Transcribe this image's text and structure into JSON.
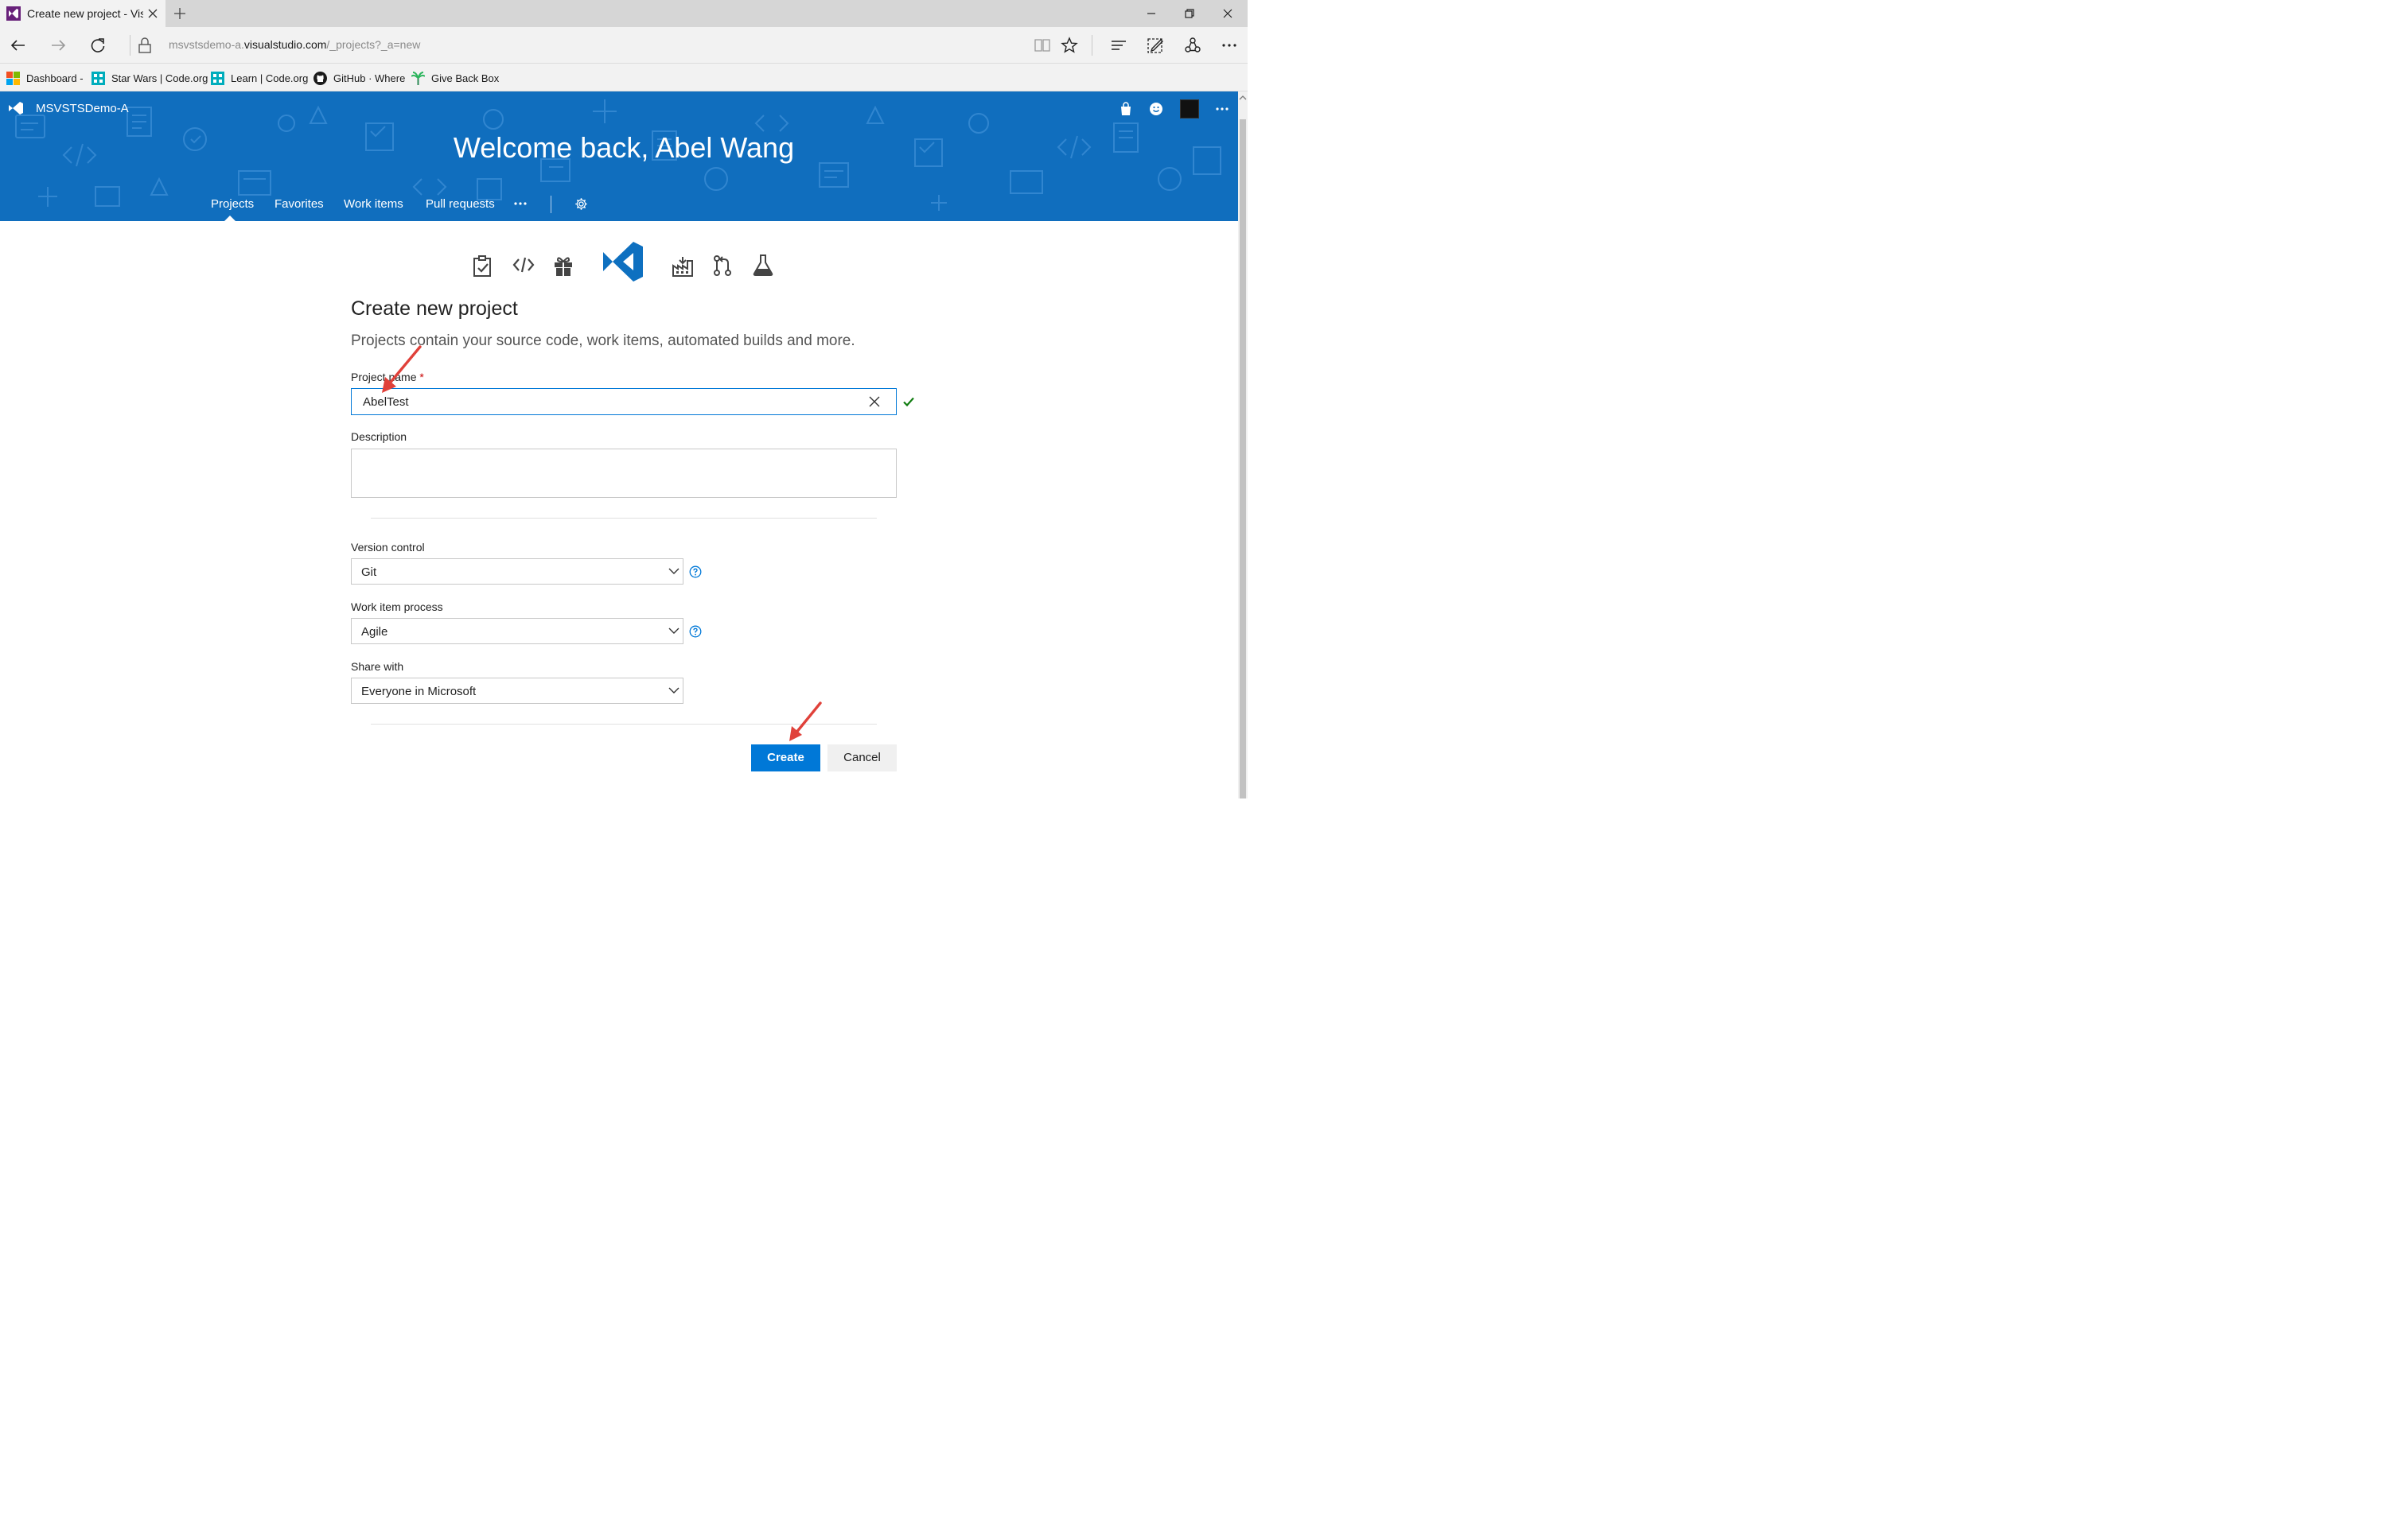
{
  "browser": {
    "tab_title": "Create new project - Vis",
    "url_prefix": "msvstsdemo-a.",
    "url_domain": "visualstudio.com",
    "url_path": "/_projects?_a=new"
  },
  "favorites": [
    {
      "label": "Dashboard -",
      "icon": "windows-logo-icon"
    },
    {
      "label": "Star Wars | Code.org",
      "icon": "code-org-icon"
    },
    {
      "label": "Learn | Code.org",
      "icon": "code-org-icon"
    },
    {
      "label": "GitHub · Where",
      "icon": "github-icon"
    },
    {
      "label": "Give Back Box",
      "icon": "palm-tree-icon"
    }
  ],
  "header": {
    "account": "MSVSTSDemo-A",
    "welcome": "Welcome back, Abel Wang",
    "nav": [
      "Projects",
      "Favorites",
      "Work items",
      "Pull requests"
    ],
    "active_nav": "Projects",
    "accent": "#106ebe"
  },
  "form": {
    "title": "Create new project",
    "subtitle": "Projects contain your source code, work items, automated builds and more.",
    "project_name_label": "Project name",
    "required_marker": "*",
    "project_name_value": "AbelTest",
    "description_label": "Description",
    "description_value": "",
    "version_control_label": "Version control",
    "version_control_value": "Git",
    "process_label": "Work item process",
    "process_value": "Agile",
    "share_label": "Share with",
    "share_value": "Everyone in Microsoft",
    "create_label": "Create",
    "cancel_label": "Cancel"
  },
  "colors": {
    "primary": "#0078d7",
    "valid": "#107c10",
    "annotation_arrow": "#e0413a"
  }
}
